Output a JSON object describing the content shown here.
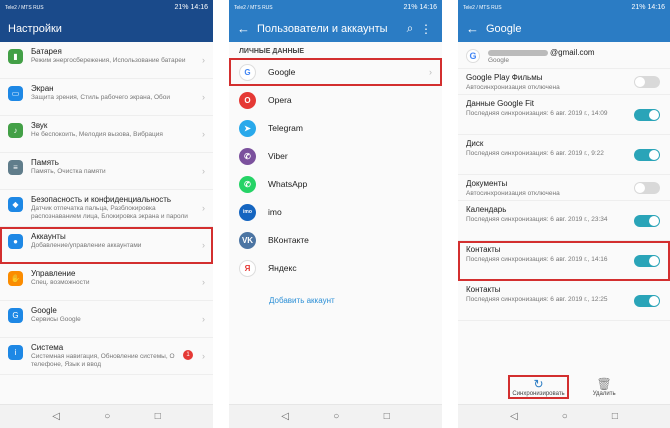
{
  "screen1": {
    "status": {
      "carrier": "Tele2 / MTS RUS",
      "right": "21% 14:16"
    },
    "title": "Настройки",
    "items": [
      {
        "title": "Батарея",
        "sub": "Режим энергосбережения, Использование батареи",
        "color": "#43a047",
        "icon": "battery-icon",
        "glyph": "▮"
      },
      {
        "title": "Экран",
        "sub": "Защита зрения, Стиль рабочего экрана, Обои",
        "color": "#1e88e5",
        "icon": "display-icon",
        "glyph": "▭"
      },
      {
        "title": "Звук",
        "sub": "Не беспокоить, Мелодия вызова, Вибрация",
        "color": "#43a047",
        "icon": "sound-icon",
        "glyph": "♪"
      },
      {
        "title": "Память",
        "sub": "Память, Очистка памяти",
        "color": "#607d8b",
        "icon": "memory-icon",
        "glyph": "≡"
      },
      {
        "title": "Безопасность и конфиденциальность",
        "sub": "Датчик отпечатка пальца, Разблокировка распознаванием лица, Блокировка экрана и пароли",
        "color": "#1e88e5",
        "icon": "shield-icon",
        "glyph": "◆"
      },
      {
        "title": "Аккаунты",
        "sub": "Добавление/управление аккаунтами",
        "color": "#1e88e5",
        "icon": "user-icon",
        "glyph": "●"
      },
      {
        "title": "Управление",
        "sub": "Спец. возможности",
        "color": "#fb8c00",
        "icon": "hand-icon",
        "glyph": "✋"
      },
      {
        "title": "Google",
        "sub": "Сервисы Google",
        "color": "#1e88e5",
        "icon": "google-icon",
        "glyph": "G"
      },
      {
        "title": "Система",
        "sub": "Системная навигация, Обновление системы, О телефоне, Язык и ввод",
        "color": "#1e88e5",
        "icon": "system-icon",
        "glyph": "i",
        "badge": "1"
      }
    ]
  },
  "screen2": {
    "status": {
      "carrier": "Tele2 / MTS RUS",
      "right": "21% 14:16"
    },
    "title": "Пользователи и аккаунты",
    "section": "ЛИЧНЫЕ ДАННЫЕ",
    "accounts": [
      {
        "label": "Google",
        "color": "#ffffff",
        "text": "#4285f4",
        "glyph": "G",
        "icon": "google-icon"
      },
      {
        "label": "Opera",
        "color": "#e53935",
        "text": "#ffffff",
        "glyph": "O",
        "icon": "opera-icon"
      },
      {
        "label": "Telegram",
        "color": "#29a9eb",
        "text": "#ffffff",
        "glyph": "➤",
        "icon": "telegram-icon"
      },
      {
        "label": "Viber",
        "color": "#7b519d",
        "text": "#ffffff",
        "glyph": "✆",
        "icon": "viber-icon"
      },
      {
        "label": "WhatsApp",
        "color": "#25d366",
        "text": "#ffffff",
        "glyph": "✆",
        "icon": "whatsapp-icon"
      },
      {
        "label": "imo",
        "color": "#1565c0",
        "text": "#ffffff",
        "glyph": "imo",
        "icon": "imo-icon"
      },
      {
        "label": "ВКонтакте",
        "color": "#4c75a3",
        "text": "#ffffff",
        "glyph": "VK",
        "icon": "vk-icon"
      },
      {
        "label": "Яндекс",
        "color": "#ffffff",
        "text": "#e53935",
        "glyph": "Я",
        "icon": "yandex-icon"
      }
    ],
    "add_account": "Добавить аккаунт"
  },
  "screen3": {
    "status": {
      "carrier": "Tele2 / MTS RUS",
      "right": "21% 14:16"
    },
    "title": "Google",
    "account": {
      "email": "@gmail.com",
      "type": "Google"
    },
    "sync": [
      {
        "title": "Google Play Фильмы",
        "sub": "Автосинхронизация отключена",
        "on": false
      },
      {
        "title": "Данные Google Fit",
        "sub": "Последняя синхронизация: 6 авг. 2019 г., 14:09",
        "on": true
      },
      {
        "title": "Диск",
        "sub": "Последняя синхронизация: 6 авг. 2019 г., 9:22",
        "on": true
      },
      {
        "title": "Документы",
        "sub": "Автосинхронизация отключена",
        "on": false
      },
      {
        "title": "Календарь",
        "sub": "Последняя синхронизация: 6 авг. 2019 г., 23:34",
        "on": true
      },
      {
        "title": "Контакты",
        "sub": "Последняя синхронизация: 6 авг. 2019 г., 14:16",
        "on": true
      },
      {
        "title": "Контакты",
        "sub": "Последняя синхронизация: 6 авг. 2019 г., 12:25",
        "on": true
      }
    ],
    "actions": {
      "sync": "Синхронизировать",
      "delete": "Удалить"
    }
  },
  "nav": {
    "back": "◁",
    "home": "○",
    "recent": "□"
  }
}
